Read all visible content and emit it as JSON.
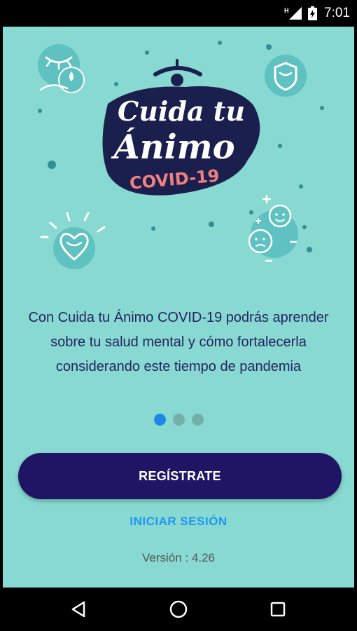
{
  "status_bar": {
    "time": "7:01",
    "network_label": "H",
    "icons": [
      "signal-icon",
      "battery-charging-icon"
    ]
  },
  "logo": {
    "line1": "Cuida tu",
    "line2": "Ánimo",
    "line3": "COVID-19"
  },
  "onboarding": {
    "message": "Con Cuida tu Ánimo COVID-19 podrás aprender sobre tu salud mental y cómo fortalecerla considerando este tiempo de pandemia",
    "page_count": 3,
    "active_page": 1
  },
  "actions": {
    "register_label": "REGÍSTRATE",
    "login_label": "INICIAR SESIÓN"
  },
  "footer": {
    "version": "Versión : 4.26"
  },
  "nav_bar": {
    "icons": [
      "back-icon",
      "home-icon",
      "recents-icon"
    ]
  },
  "colors": {
    "background": "#87d9d1",
    "primary_button": "#201464",
    "link": "#2196f3",
    "text": "#262262",
    "dot_active": "#1e88e5",
    "dot_inactive": "#73b0ac"
  }
}
